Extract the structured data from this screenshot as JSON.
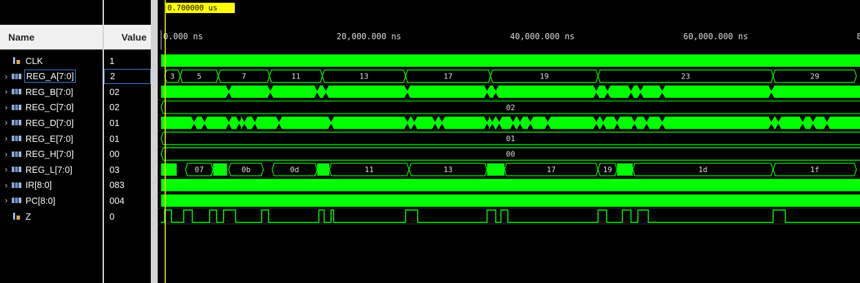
{
  "cursor": {
    "label": "0.700000 us"
  },
  "headers": {
    "name": "Name",
    "value": "Value"
  },
  "timeline": {
    "ticks": [
      {
        "t": 0,
        "label": "0.000 ns"
      },
      {
        "t": 20000,
        "label": "20,000.000 ns"
      },
      {
        "t": 40000,
        "label": "40,000.000 ns"
      },
      {
        "t": 60000,
        "label": "60,000.000 ns"
      },
      {
        "t": 80000,
        "label": "8"
      }
    ]
  },
  "signals": [
    {
      "name": "CLK",
      "value": "1",
      "kind": "bit",
      "expandable": false,
      "wave": "solid"
    },
    {
      "name": "REG_A[7:0]",
      "value": "2",
      "kind": "bus",
      "expandable": true,
      "wave": "bus",
      "segments": [
        [
          "3",
          0.4,
          2.2
        ],
        [
          "5",
          2.2,
          6.6
        ],
        [
          "7",
          6.6,
          12.5
        ],
        [
          "11",
          12.5,
          18.6
        ],
        [
          "13",
          18.6,
          28.2
        ],
        [
          "17",
          28.2,
          38.0
        ],
        [
          "19",
          38.0,
          50.4
        ],
        [
          "23",
          50.4,
          70.6
        ],
        [
          "29",
          70.6,
          80.2
        ]
      ]
    },
    {
      "name": "REG_B[7:0]",
      "value": "02",
      "kind": "bus",
      "expandable": true,
      "wave": "bursty",
      "breaks": [
        7.8,
        12.6,
        18.0,
        19.0,
        28.4,
        37.6,
        38.6,
        50.2,
        51.5,
        54.2,
        55.3,
        57.8,
        70.4
      ]
    },
    {
      "name": "REG_C[7:0]",
      "value": "02",
      "kind": "bus",
      "expandable": true,
      "wave": "const",
      "text": "02"
    },
    {
      "name": "REG_D[7:0]",
      "value": "01",
      "kind": "bus",
      "expandable": true,
      "wave": "bursty",
      "breaks": [
        3.8,
        5.0,
        7.8,
        9.0,
        9.6,
        10.8,
        13.6,
        19.6,
        28.4,
        29.2,
        31.6,
        32.4,
        37.6,
        38.2,
        39.0,
        40.6,
        41.4,
        42.6,
        44.6,
        50.2,
        51.0,
        52.6,
        54.6,
        56.0,
        57.8,
        70.4,
        71.2,
        74.0,
        75.2,
        76.8
      ]
    },
    {
      "name": "REG_E[7:0]",
      "value": "01",
      "kind": "bus",
      "expandable": true,
      "wave": "const",
      "text": "01"
    },
    {
      "name": "REG_H[7:0]",
      "value": "00",
      "kind": "bus",
      "expandable": true,
      "wave": "const",
      "text": "00"
    },
    {
      "name": "REG_L[7:0]",
      "value": "03",
      "kind": "bus",
      "expandable": true,
      "wave": "busmix",
      "segments": [
        [
          "",
          0.0,
          1.8,
          "solid"
        ],
        [
          "07",
          2.8,
          6.0,
          "open"
        ],
        [
          "",
          6.0,
          7.6,
          "solid"
        ],
        [
          "0b",
          7.8,
          11.8,
          "open"
        ],
        [
          "0d",
          12.8,
          18.0,
          "open"
        ],
        [
          "",
          18.0,
          19.4,
          "solid"
        ],
        [
          "11",
          19.4,
          28.6,
          "open"
        ],
        [
          "13",
          28.6,
          37.6,
          "open"
        ],
        [
          "",
          37.6,
          39.6,
          "solid"
        ],
        [
          "17",
          39.6,
          50.4,
          "open"
        ],
        [
          "19",
          50.4,
          52.6,
          "open"
        ],
        [
          "",
          52.6,
          54.4,
          "solid"
        ],
        [
          "1d",
          54.4,
          70.6,
          "open"
        ],
        [
          "1f",
          70.6,
          80.2,
          "open"
        ]
      ]
    },
    {
      "name": "IR[8:0]",
      "value": "083",
      "kind": "bus",
      "expandable": true,
      "wave": "solid"
    },
    {
      "name": "PC[8:0]",
      "value": "004",
      "kind": "bus",
      "expandable": true,
      "wave": "solid"
    },
    {
      "name": "Z",
      "value": "0",
      "kind": "bit",
      "expandable": false,
      "wave": "pulses",
      "pulses": [
        [
          0.4,
          1.2
        ],
        [
          2.6,
          3.6
        ],
        [
          5.6,
          6.4
        ],
        [
          7.2,
          8.6
        ],
        [
          11.6,
          12.4
        ],
        [
          18.2,
          18.8
        ],
        [
          19.6,
          19.9
        ],
        [
          28.2,
          29.6
        ],
        [
          37.6,
          38.6
        ],
        [
          39.2,
          40.0
        ],
        [
          50.4,
          51.4
        ],
        [
          53.2,
          54.2
        ],
        [
          55.0,
          56.2
        ],
        [
          70.6,
          72.0
        ]
      ]
    }
  ]
}
